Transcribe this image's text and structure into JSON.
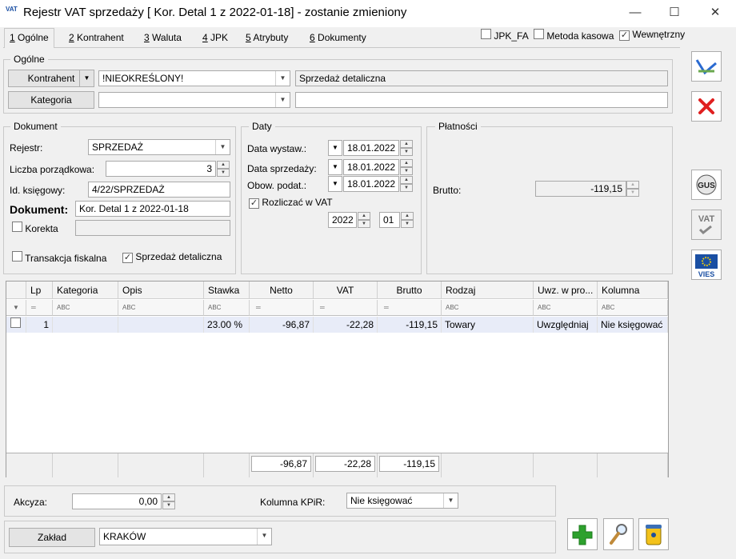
{
  "window": {
    "app_icon": "VAT",
    "title": "Rejestr VAT sprzedaży [ Kor. Detal 1  z 2022-01-18] - zostanie zmieniony"
  },
  "tabs": [
    {
      "key": "1",
      "label": " Ogólne"
    },
    {
      "key": "2",
      "label": " Kontrahent"
    },
    {
      "key": "3",
      "label": " Waluta"
    },
    {
      "key": "4",
      "label": " JPK"
    },
    {
      "key": "5",
      "label": " Atrybuty"
    },
    {
      "key": "6",
      "label": " Dokumenty"
    }
  ],
  "top_checks": {
    "jpk_fa": "JPK_FA",
    "metoda": "Metoda kasowa",
    "wewn": "Wewnętrzny"
  },
  "ogolne": {
    "title": "Ogólne",
    "kontrahent_btn": "Kontrahent",
    "kontrahent_value": "!NIEOKREŚLONY!",
    "kontrahent_name": "Sprzedaż detaliczna",
    "kategoria_btn": "Kategoria",
    "kategoria_value": "",
    "kategoria_desc": ""
  },
  "dokument": {
    "title": "Dokument",
    "rejestr_label": "Rejestr:",
    "rejestr_value": "SPRZEDAŻ",
    "lp_label": "Liczba porządkowa:",
    "lp_value": "3",
    "idk_label": "Id. księgowy:",
    "idk_value": "4/22/SPRZEDAŻ",
    "dok_label": "Dokument:",
    "dok_value": "Kor. Detal 1  z 2022-01-18",
    "korekta_label": "Korekta",
    "korekta_value": "",
    "fiskalna_label": "Transakcja fiskalna",
    "detal_label": "Sprzedaż detaliczna"
  },
  "daty": {
    "title": "Daty",
    "wyst_label": "Data wystaw.:",
    "wyst_value": "18.01.2022",
    "sprz_label": "Data sprzedaży:",
    "sprz_value": "18.01.2022",
    "obow_label": "Obow. podat.:",
    "obow_value": "18.01.2022",
    "rozl_label": "Rozliczać w VAT",
    "rok": "2022",
    "miesiac": "01"
  },
  "platnosci": {
    "title": "Płatności",
    "brutto_label": "Brutto:",
    "brutto_value": "-119,15"
  },
  "table": {
    "columns": [
      "Lp",
      "Kategoria",
      "Opis",
      "Stawka",
      "Netto",
      "VAT",
      "Brutto",
      "Rodzaj",
      "Uwz. w pro...",
      "Kolumna"
    ],
    "row": {
      "lp": "1",
      "kategoria": "",
      "opis": "",
      "stawka": "23.00 %",
      "netto": "-96,87",
      "vat": "-22,28",
      "brutto": "-119,15",
      "rodzaj": "Towary",
      "uwz": "Uwzględniaj",
      "kolumna": "Nie księgować"
    },
    "totals": {
      "netto": "-96,87",
      "vat": "-22,28",
      "brutto": "-119,15"
    }
  },
  "akcyza": {
    "label": "Akcyza:",
    "value": "0,00",
    "kpir_label": "Kolumna KPiR:",
    "kpir_value": "Nie księgować"
  },
  "zaklad": {
    "btn": "Zakład",
    "value": "KRAKÓW"
  },
  "side": {
    "gus": "GUS",
    "vat": "VAT",
    "vies": "VIES"
  },
  "colors": {
    "accent": "#1a5fb4",
    "selected_row": "#e8ecf8",
    "cancel": "#e02020",
    "add": "#2da12d"
  }
}
